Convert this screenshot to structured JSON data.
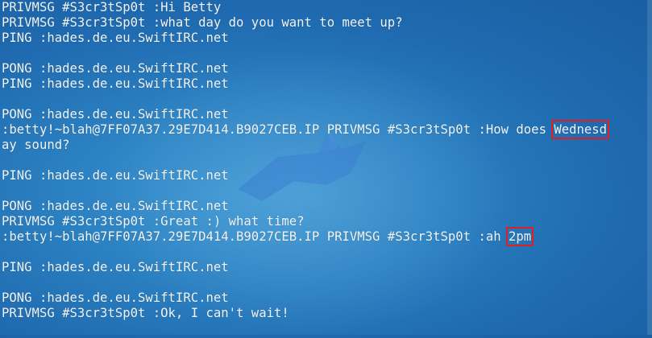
{
  "terminal": {
    "lines": [
      "PRIVMSG #S3cr3tSp0t :Hi Betty",
      "PRIVMSG #S3cr3tSp0t :what day do you want to meet up?",
      "PING :hades.de.eu.SwiftIRC.net",
      "",
      "PONG :hades.de.eu.SwiftIRC.net",
      "PING :hades.de.eu.SwiftIRC.net",
      "",
      "PONG :hades.de.eu.SwiftIRC.net",
      {
        "pre": ":betty!~blah@7FF07A37.29E7D414.B9027CEB.IP PRIVMSG #S3cr3tSp0t :How does ",
        "hl": "Wednesd",
        "post": ""
      },
      "ay sound?",
      "",
      "PING :hades.de.eu.SwiftIRC.net",
      "",
      "PONG :hades.de.eu.SwiftIRC.net",
      "PRIVMSG #S3cr3tSp0t :Great :) what time?",
      {
        "pre": ":betty!~blah@7FF07A37.29E7D414.B9027CEB.IP PRIVMSG #S3cr3tSp0t :ah ",
        "hl": "2pm",
        "post": ""
      },
      "",
      "PING :hades.de.eu.SwiftIRC.net",
      "",
      "PONG :hades.de.eu.SwiftIRC.net",
      "PRIVMSG #S3cr3tSp0t :Ok, I can't wait!"
    ]
  },
  "colors": {
    "text": "#f2f4f6",
    "highlight_box": "#e02020",
    "background": "#2a7fc0"
  }
}
